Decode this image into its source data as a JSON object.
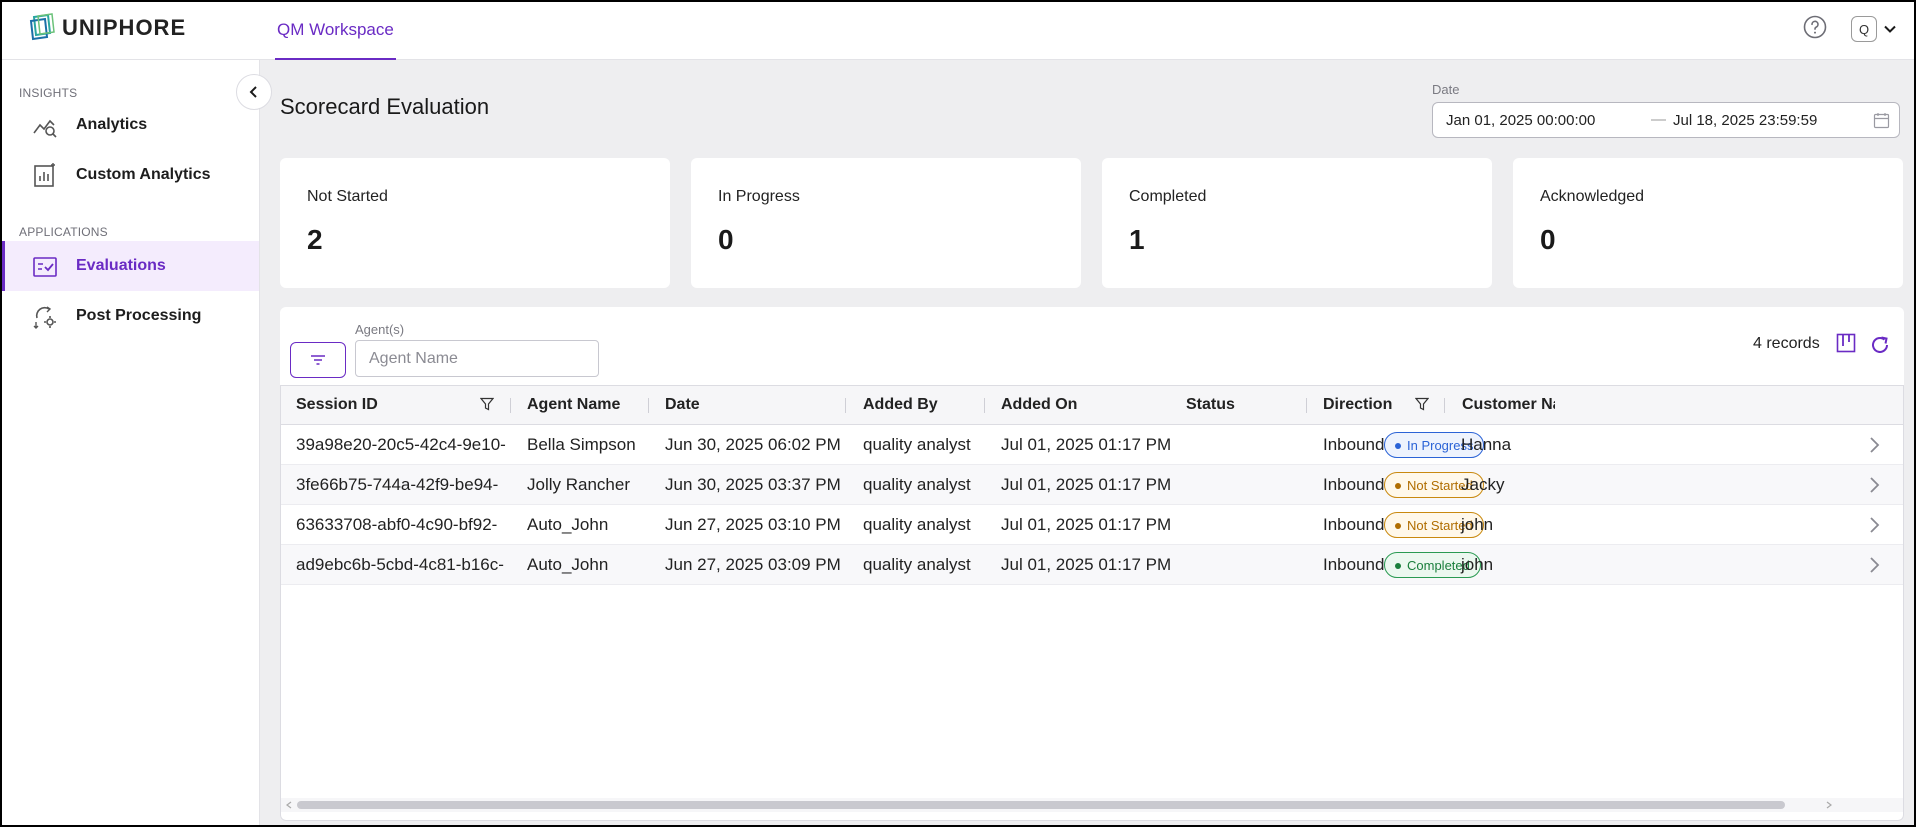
{
  "app": {
    "brand": "UNIPHORE",
    "tab": "QM Workspace",
    "user_initial": "Q"
  },
  "sidebar": {
    "insights_label": "INSIGHTS",
    "applications_label": "APPLICATIONS",
    "items": [
      {
        "label": "Analytics",
        "icon": "analytics-icon"
      },
      {
        "label": "Custom Analytics",
        "icon": "custom-analytics-icon"
      },
      {
        "label": "Evaluations",
        "icon": "evaluations-icon",
        "active": true
      },
      {
        "label": "Post Processing",
        "icon": "post-processing-icon"
      }
    ]
  },
  "page": {
    "title": "Scorecard Evaluation",
    "date_label": "Date",
    "date_start": "Jan 01, 2025 00:00:00",
    "date_separator": "—",
    "date_end": "Jul 18, 2025 23:59:59"
  },
  "stats": [
    {
      "label": "Not Started",
      "value": "2"
    },
    {
      "label": "In Progress",
      "value": "0"
    },
    {
      "label": "Completed",
      "value": "1"
    },
    {
      "label": "Acknowledged",
      "value": "0"
    }
  ],
  "filters": {
    "agent_label": "Agent(s)",
    "agent_placeholder": "Agent Name",
    "records": "4 records"
  },
  "table": {
    "columns": [
      "Session ID",
      "Agent Name",
      "Date",
      "Added By",
      "Added On",
      "Status",
      "Direction",
      "Customer Nam"
    ],
    "rows": [
      {
        "session_id": "39a98e20-20c5-42c4-9e10-",
        "agent": "Bella Simpson",
        "date": "Jun 30, 2025 06:02 PM",
        "added_by": "quality analyst",
        "added_on": "Jul 01, 2025 01:17 PM",
        "status": "In Progress",
        "direction": "Inbound",
        "customer": "Hanna"
      },
      {
        "session_id": "3fe66b75-744a-42f9-be94-",
        "agent": "Jolly Rancher",
        "date": "Jun 30, 2025 03:37 PM",
        "added_by": "quality analyst",
        "added_on": "Jul 01, 2025 01:17 PM",
        "status": "Not Started",
        "direction": "Inbound",
        "customer": "Jacky"
      },
      {
        "session_id": "63633708-abf0-4c90-bf92-",
        "agent": "Auto_John",
        "date": "Jun 27, 2025 03:10 PM",
        "added_by": "quality analyst",
        "added_on": "Jul 01, 2025 01:17 PM",
        "status": "Not Started",
        "direction": "Inbound",
        "customer": "john"
      },
      {
        "session_id": "ad9ebc6b-5cbd-4c81-b16c-",
        "agent": "Auto_John",
        "date": "Jun 27, 2025 03:09 PM",
        "added_by": "quality analyst",
        "added_on": "Jul 01, 2025 01:17 PM",
        "status": "Completed",
        "direction": "Inbound",
        "customer": "john"
      }
    ]
  },
  "colors": {
    "accent": "#6a2bc4",
    "status_in_progress": "#2b63d6",
    "status_not_started": "#b06d00",
    "status_completed": "#1a7f3c"
  }
}
